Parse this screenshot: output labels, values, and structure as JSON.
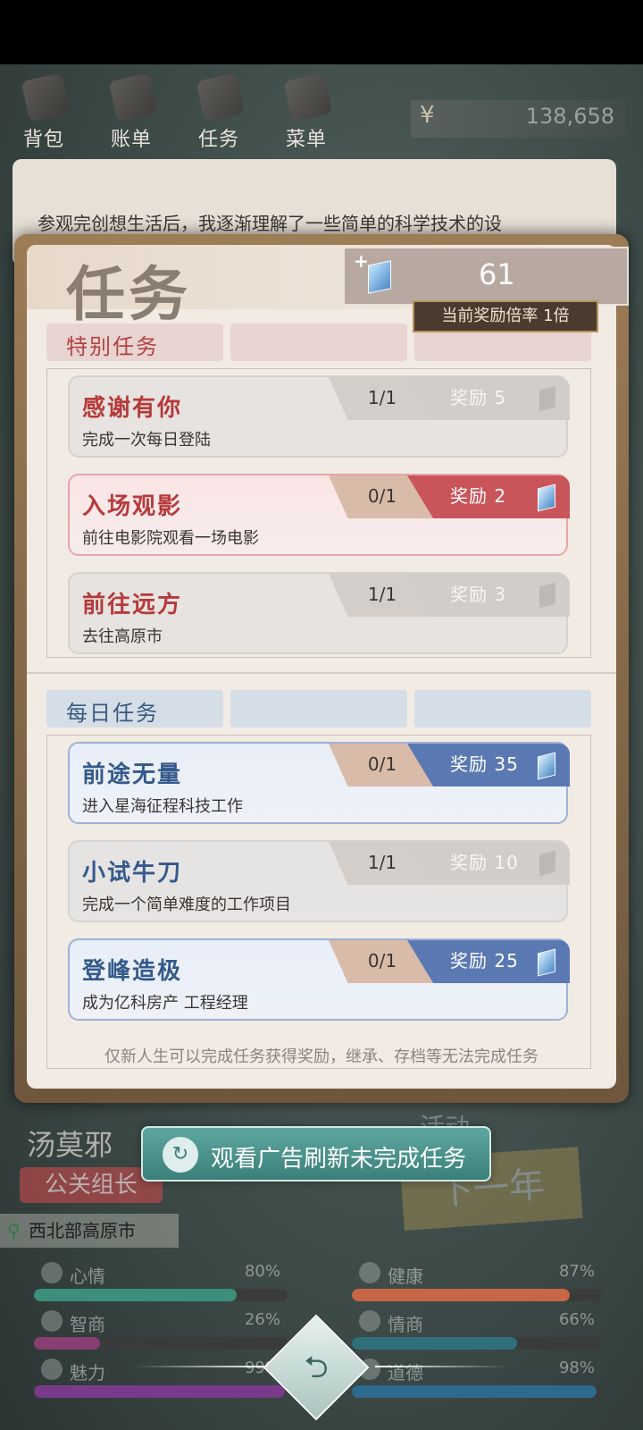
{
  "background": {
    "nav": [
      {
        "label": "背包",
        "icon": "backpack-icon"
      },
      {
        "label": "账单",
        "icon": "bill-icon"
      },
      {
        "label": "任务",
        "icon": "task-icon"
      },
      {
        "label": "菜单",
        "icon": "menu-icon"
      }
    ],
    "money": {
      "symbol": "¥",
      "amount": "138,658"
    },
    "story_text": "参观完创想生活后，我逐渐理解了一些简单的科学技术的设",
    "character": {
      "name": "汤莫邪",
      "title": "公关组长",
      "location": "西北部高原市"
    },
    "activity_label": "活动",
    "next_year_label": "下一年",
    "stats": [
      {
        "name": "心情",
        "value": "80%",
        "level": 0.8,
        "color": "#3c8f7c",
        "icon": "mood-icon"
      },
      {
        "name": "健康",
        "value": "87%",
        "level": 0.87,
        "color": "#c86646",
        "icon": "health-icon"
      },
      {
        "name": "智商",
        "value": "26%",
        "level": 0.26,
        "color": "#8a3f73",
        "icon": "iq-icon"
      },
      {
        "name": "情商",
        "value": "66%",
        "level": 0.66,
        "color": "#2f6f7a",
        "icon": "eq-icon"
      },
      {
        "name": "魅力",
        "value": "99%",
        "level": 0.99,
        "color": "#7a3a8a",
        "icon": "charm-icon"
      },
      {
        "name": "道德",
        "value": "98%",
        "level": 0.98,
        "color": "#2d6a8e",
        "icon": "morality-icon"
      }
    ],
    "back_glyph": "⮌"
  },
  "modal": {
    "title": "任务",
    "gem_count": "61",
    "gem_plus": "+",
    "multiplier_text": "当前奖励倍率 1倍",
    "special_section_label": "特别任务",
    "daily_section_label": "每日任务",
    "special_tasks": [
      {
        "name": "感谢有你",
        "desc": "完成一次每日登陆",
        "progress": "1/1",
        "reward": "奖励 5",
        "state": "done"
      },
      {
        "name": "入场观影",
        "desc": "前往电影院观看一场电影",
        "progress": "0/1",
        "reward": "奖励 2",
        "state": "active"
      },
      {
        "name": "前往远方",
        "desc": "去往高原市",
        "progress": "1/1",
        "reward": "奖励 3",
        "state": "done"
      }
    ],
    "daily_tasks": [
      {
        "name": "前途无量",
        "desc": "进入星海征程科技工作",
        "progress": "0/1",
        "reward": "奖励 35",
        "state": "active"
      },
      {
        "name": "小试牛刀",
        "desc": "完成一个简单难度的工作项目",
        "progress": "1/1",
        "reward": "奖励 10",
        "state": "done"
      },
      {
        "name": "登峰造极",
        "desc": "成为亿科房产 工程经理",
        "progress": "0/1",
        "reward": "奖励 25",
        "state": "active"
      }
    ],
    "footer_note": "仅新人生可以完成任务获得奖励，继承、存档等无法完成任务"
  },
  "ad_button": {
    "label": "观看广告刷新未完成任务",
    "icon": "replay-icon"
  }
}
